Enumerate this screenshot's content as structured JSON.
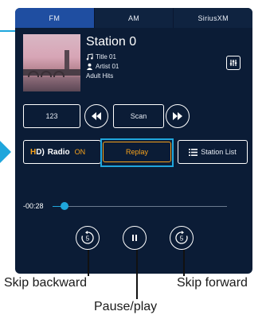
{
  "tabs": [
    "FM",
    "AM",
    "SiriusXM"
  ],
  "station": {
    "name": "Station 0",
    "title": "Title 01",
    "artist": "Artist 01",
    "genre": "Adult Hits"
  },
  "controls": {
    "preset_label": "123",
    "scan_label": "Scan",
    "hd_radio_label": "Radio",
    "hd_radio_status": "ON",
    "replay_label": "Replay",
    "station_list_label": "Station List"
  },
  "playback": {
    "elapsed": "-00:28",
    "progress": 0.07
  },
  "annotations": {
    "skip_backward": "Skip backward",
    "pause_play": "Pause/play",
    "skip_forward": "Skip forward"
  },
  "colors": {
    "screen_bg": "#0b1c36",
    "tab_active": "#1f4ea1",
    "accent_orange": "#f7a21b",
    "accent_blue": "#1fa6dc"
  },
  "icons": {
    "rewind": "rewind-icon",
    "fast_forward": "fast-forward-icon",
    "skip_back": "skip-back-5-icon",
    "pause": "pause-icon",
    "skip_forward": "skip-forward-5-icon",
    "equalizer": "equalizer-icon"
  }
}
